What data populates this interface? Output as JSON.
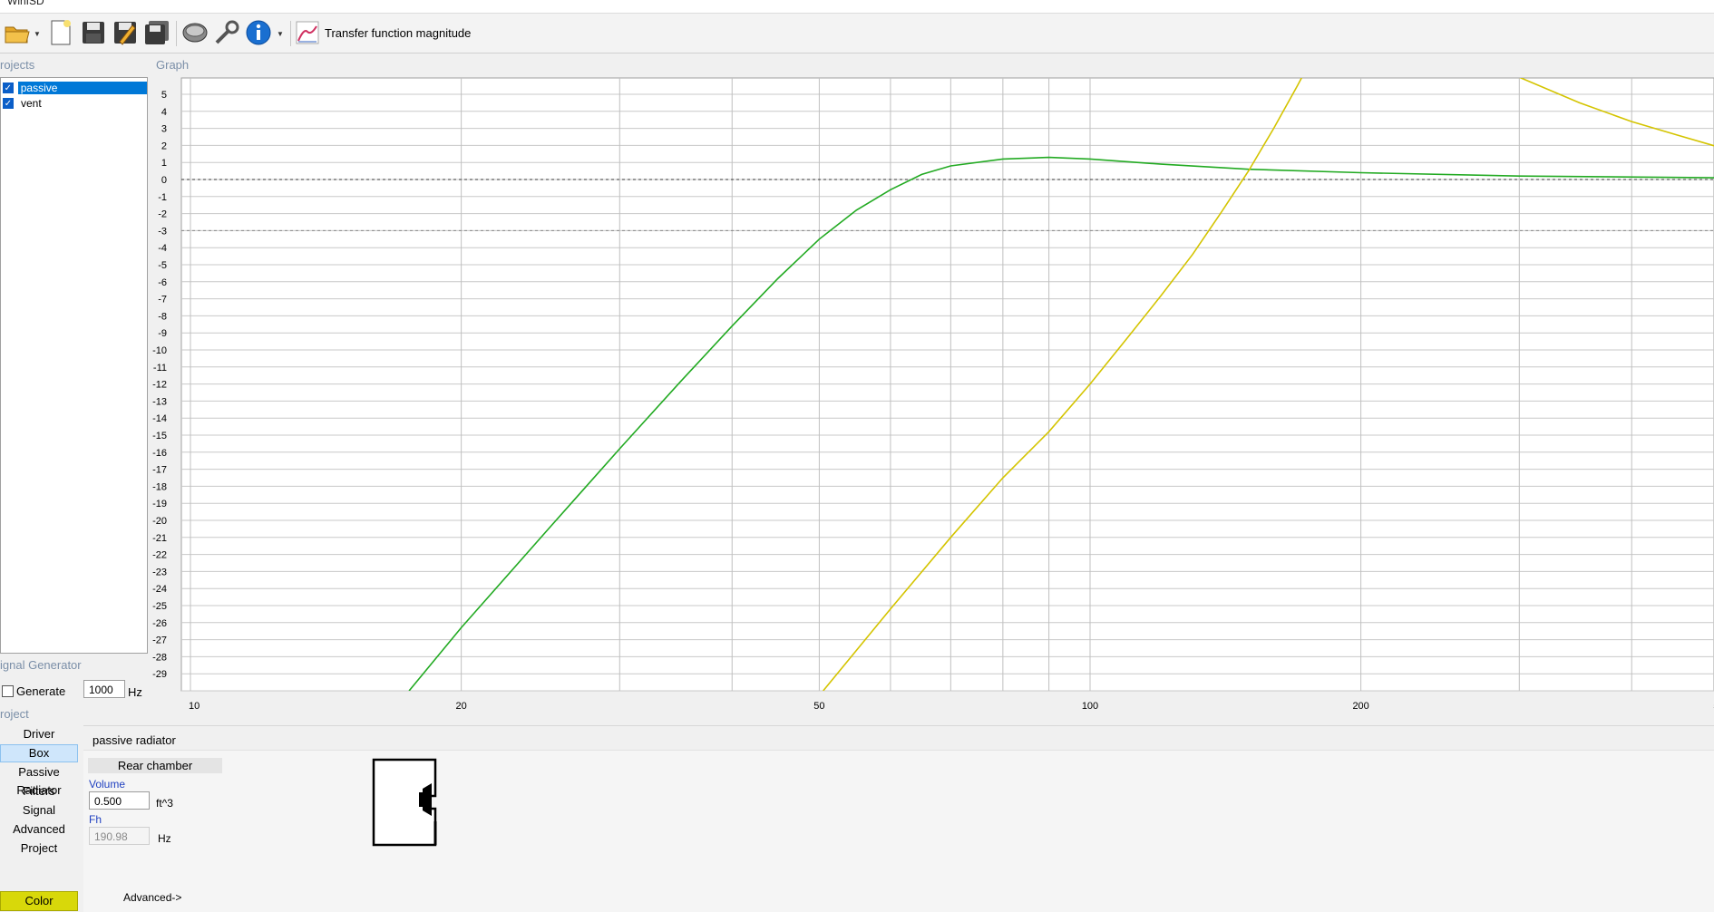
{
  "window": {
    "title": "WinISD"
  },
  "toolbar": {
    "buttons": [
      {
        "name": "open-folder-icon"
      },
      {
        "name": "new-file-icon"
      },
      {
        "name": "save-icon"
      },
      {
        "name": "edit-icon"
      },
      {
        "name": "save-all-icon"
      },
      {
        "name": "driver-icon"
      },
      {
        "name": "tools-icon"
      },
      {
        "name": "info-icon"
      }
    ],
    "transfer_label": "Transfer function magnitude"
  },
  "projects": {
    "label": "rojects",
    "items": [
      {
        "label": "passive",
        "checked": true,
        "selected": true
      },
      {
        "label": "vent",
        "checked": true,
        "selected": false
      }
    ]
  },
  "graph": {
    "label": "Graph"
  },
  "signal_generator": {
    "label": "ignal Generator",
    "generate_label": "Generate",
    "frequency": "1000",
    "unit": "Hz"
  },
  "project_nav": {
    "label": "roject",
    "items": [
      {
        "label": "Driver",
        "selected": false
      },
      {
        "label": "Box",
        "selected": true
      },
      {
        "label": "Passive Radiator",
        "selected": false
      },
      {
        "label": "Filters",
        "selected": false
      },
      {
        "label": "Signal",
        "selected": false
      },
      {
        "label": "Advanced",
        "selected": false
      },
      {
        "label": "Project",
        "selected": false
      }
    ],
    "color_label": "Color",
    "color": "#d8d80a"
  },
  "box_panel": {
    "title": "passive radiator",
    "rear_chamber": "Rear chamber",
    "volume_label": "Volume",
    "volume_value": "0.500",
    "volume_unit": "ft^3",
    "fh_label": "Fh",
    "fh_value": "190.98",
    "fh_unit": "Hz",
    "advanced": "Advanced->"
  },
  "chart_data": {
    "type": "line",
    "x_scale": "log",
    "xlim": [
      10,
      500
    ],
    "ylim": [
      -30,
      6
    ],
    "x_ticks": [
      "10",
      "20",
      "50",
      "100",
      "200",
      "50"
    ],
    "y_ticks": [
      "5",
      "4",
      "3",
      "2",
      "1",
      "0",
      "-1",
      "-2",
      "-3",
      "-4",
      "-5",
      "-6",
      "-7",
      "-8",
      "-9",
      "-10",
      "-11",
      "-12",
      "-13",
      "-14",
      "-15",
      "-16",
      "-17",
      "-18",
      "-19",
      "-20",
      "-21",
      "-22",
      "-23",
      "-24",
      "-25",
      "-26",
      "-27",
      "-28",
      "-29"
    ],
    "grid": true,
    "reference_lines": [
      0,
      -3
    ],
    "series": [
      {
        "color": "#22aa22",
        "points": [
          [
            17.5,
            -30
          ],
          [
            20,
            -26.3
          ],
          [
            25,
            -20.5
          ],
          [
            30,
            -15.8
          ],
          [
            35,
            -11.9
          ],
          [
            40,
            -8.6
          ],
          [
            45,
            -5.8
          ],
          [
            50,
            -3.5
          ],
          [
            55,
            -1.8
          ],
          [
            60,
            -0.6
          ],
          [
            65,
            0.3
          ],
          [
            70,
            0.8
          ],
          [
            80,
            1.2
          ],
          [
            90,
            1.3
          ],
          [
            100,
            1.2
          ],
          [
            120,
            0.9
          ],
          [
            150,
            0.6
          ],
          [
            200,
            0.4
          ],
          [
            300,
            0.2
          ],
          [
            500,
            0.1
          ]
        ]
      },
      {
        "color": "#d4c400",
        "points": [
          [
            50.5,
            -30
          ],
          [
            60,
            -25.2
          ],
          [
            70,
            -21
          ],
          [
            80,
            -17.5
          ],
          [
            90,
            -14.8
          ],
          [
            100,
            -12
          ],
          [
            110,
            -9.3
          ],
          [
            120,
            -6.8
          ],
          [
            130,
            -4.4
          ],
          [
            140,
            -1.9
          ],
          [
            150,
            0.5
          ],
          [
            160,
            3
          ],
          [
            170,
            5.5
          ],
          [
            172,
            6
          ]
        ]
      },
      {
        "color": "#d4c400",
        "points": [
          [
            300,
            6
          ],
          [
            350,
            4.5
          ],
          [
            400,
            3.4
          ],
          [
            450,
            2.6
          ],
          [
            500,
            1.9
          ],
          [
            540,
            1.4
          ]
        ]
      }
    ]
  }
}
